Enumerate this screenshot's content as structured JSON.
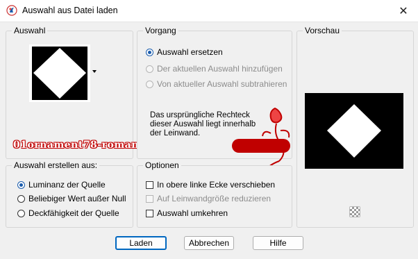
{
  "window": {
    "title": "Auswahl aus Datei laden",
    "close_glyph": "✕"
  },
  "groups": {
    "auswahl": "Auswahl",
    "vorgang": "Vorgang",
    "vorschau": "Vorschau",
    "erstellen": "Auswahl erstellen aus:",
    "optionen": "Optionen"
  },
  "vorgang": {
    "options": [
      {
        "label": "Auswahl ersetzen",
        "selected": true,
        "enabled": true
      },
      {
        "label": "Der aktuellen Auswahl hinzufügen",
        "selected": false,
        "enabled": false
      },
      {
        "label": "Von aktueller Auswahl subtrahieren",
        "selected": false,
        "enabled": false
      }
    ],
    "info": "Das ursprüngliche Rechteck dieser Auswahl liegt innerhalb der Leinwand."
  },
  "erstellen": {
    "options": [
      {
        "label": "Luminanz der Quelle",
        "selected": true
      },
      {
        "label": "Beliebiger Wert außer Null",
        "selected": false
      },
      {
        "label": "Deckfähigkeit der Quelle",
        "selected": false
      }
    ]
  },
  "optionen": {
    "items": [
      {
        "label": "In obere linke Ecke verschieben",
        "checked": false,
        "enabled": true
      },
      {
        "label": "Auf Leinwandgröße reduzieren",
        "checked": false,
        "enabled": false
      },
      {
        "label": "Auswahl umkehren",
        "checked": false,
        "enabled": true
      }
    ]
  },
  "watermark": "01ornament78-romana1",
  "buttons": {
    "load": "Laden",
    "cancel": "Abbrechen",
    "help": "Hilfe"
  },
  "colors": {
    "accent": "#0067c0",
    "radio_selected": "#1a5cad",
    "watermark": "#c00000"
  }
}
